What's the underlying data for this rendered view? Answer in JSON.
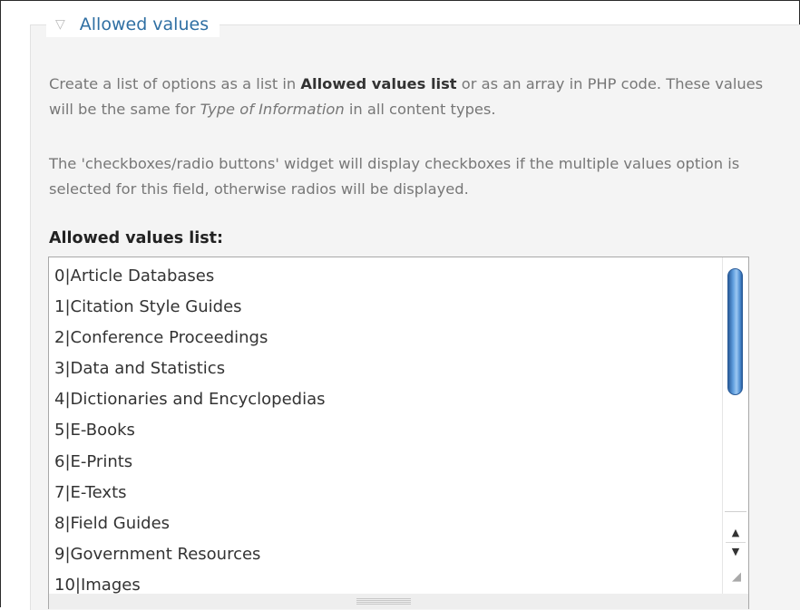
{
  "fieldset": {
    "collapse_icon": "▽",
    "legend": "Allowed values"
  },
  "description": {
    "p1": {
      "prefix": "Create a list of options as a list in ",
      "bold": "Allowed values list",
      "middle": " or as an array in PHP code. These values will be the same for ",
      "italic": "Type of Information",
      "suffix": " in all content types."
    },
    "p2": "The 'checkboxes/radio buttons' widget will display checkboxes if the multiple values option is selected for this field, otherwise radios will be displayed."
  },
  "allowed_values": {
    "label": "Allowed values list:",
    "lines": [
      "0|Article Databases",
      "1|Citation Style Guides",
      "2|Conference Proceedings",
      "3|Data and Statistics",
      "4|Dictionaries and Encyclopedias",
      "5|E-Books",
      "6|E-Prints",
      "7|E-Texts",
      "8|Field Guides",
      "9|Government Resources",
      "10|Images"
    ]
  },
  "scrollbar": {
    "up_arrow": "▲",
    "down_arrow": "▼",
    "resize_glyph": "◢"
  },
  "colors": {
    "legend_link": "#2f6fa3",
    "scroll_thumb": "#4f8fd3",
    "fieldset_bg": "#f4f4f4"
  }
}
